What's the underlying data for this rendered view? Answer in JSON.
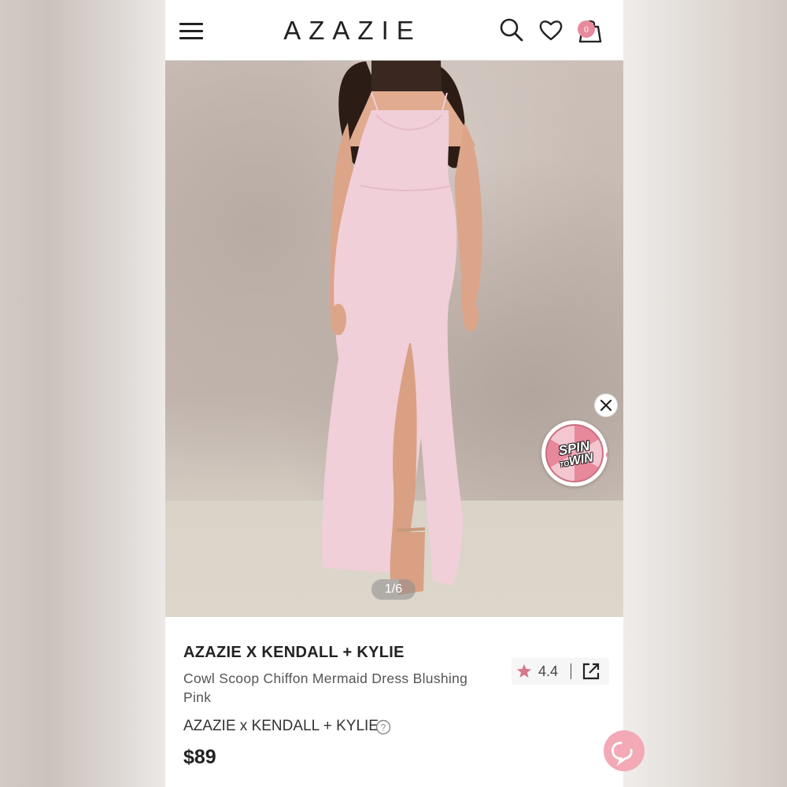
{
  "header": {
    "logo": "AZAZIE",
    "menu_icon": "hamburger-menu-icon",
    "search_icon": "search-icon",
    "wishlist_icon": "heart-icon",
    "cart_icon": "shopping-bag-icon",
    "cart_count": "0"
  },
  "gallery": {
    "slide_counter": "1/6",
    "current_slide": 1,
    "total_slides": 6
  },
  "promo": {
    "spin_line1": "SPIN",
    "spin_to": "TO",
    "spin_win": "WIN",
    "close_icon": "close-icon"
  },
  "product": {
    "brand_title": "AZAZIE X KENDALL + KYLIE",
    "name": "Cowl Scoop Chiffon Mermaid Dress Blushing Pink",
    "rating": "4.4",
    "collection": "AZAZIE x KENDALL + KYLIE",
    "price": "$89"
  },
  "colors": {
    "accent_pink": "#e88a9c",
    "chat_pink": "#f3a9b6",
    "star": "#d9788a",
    "dress": "#f0cfd8"
  }
}
